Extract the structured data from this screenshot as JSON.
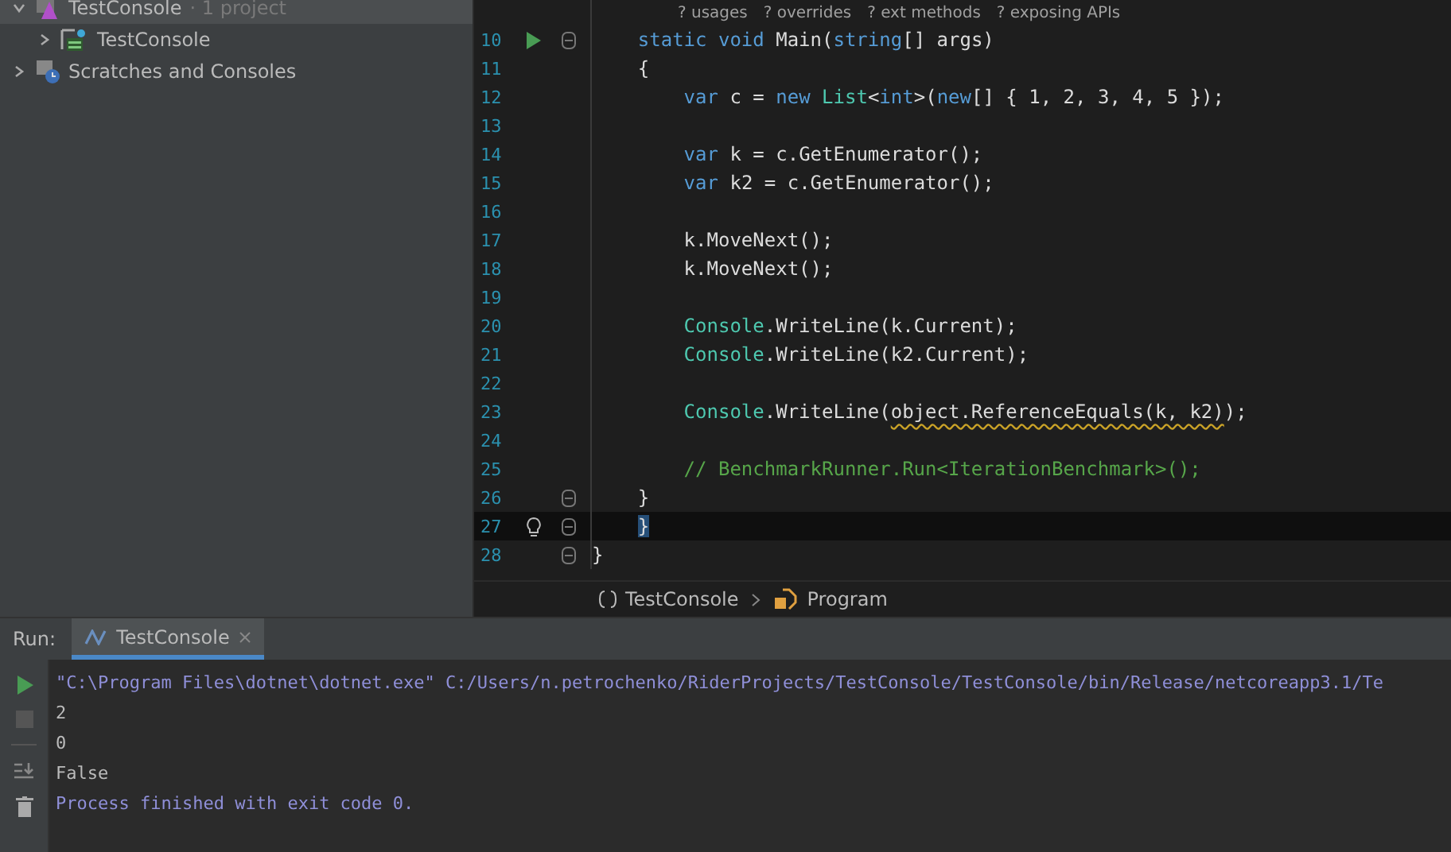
{
  "project_tree": [
    {
      "label": "TestConsole",
      "note": "· 1 project",
      "kind": "solution",
      "expanded": true,
      "selected": true,
      "children": [
        {
          "label": "TestConsole",
          "kind": "project",
          "expanded": false,
          "selected": false
        }
      ]
    },
    {
      "label": "Scratches and Consoles",
      "kind": "scratches",
      "expanded": false,
      "selected": false
    }
  ],
  "editor": {
    "code_lens": [
      "? usages",
      "? overrides",
      "? ext methods",
      "? exposing APIs"
    ],
    "lines": [
      {
        "number": "10",
        "kind": "runnable",
        "fold": true,
        "current": false,
        "tokens": [
          {
            "kind": "kw",
            "text": "    static void "
          },
          {
            "kind": "plain",
            "text": "Main("
          },
          {
            "kind": "kw",
            "text": "string"
          },
          {
            "kind": "plain",
            "text": "[] args)"
          }
        ]
      },
      {
        "number": "11",
        "kind": "plain",
        "fold": false,
        "current": false,
        "tokens": [
          {
            "kind": "plain",
            "text": "    {"
          }
        ]
      },
      {
        "number": "12",
        "kind": "plain",
        "fold": false,
        "current": false,
        "tokens": [
          {
            "kind": "kw",
            "text": "        var"
          },
          {
            "kind": "plain",
            "text": " c = "
          },
          {
            "kind": "kw",
            "text": "new "
          },
          {
            "kind": "type",
            "text": "List"
          },
          {
            "kind": "plain",
            "text": "<"
          },
          {
            "kind": "kw",
            "text": "int"
          },
          {
            "kind": "plain",
            "text": ">("
          },
          {
            "kind": "kw",
            "text": "new"
          },
          {
            "kind": "plain",
            "text": "[] { 1, 2, 3, 4, 5 });"
          }
        ]
      },
      {
        "number": "13",
        "kind": "plain",
        "fold": false,
        "current": false
      },
      {
        "number": "14",
        "kind": "plain",
        "fold": false,
        "current": false,
        "tokens": [
          {
            "kind": "kw",
            "text": "        var"
          },
          {
            "kind": "plain",
            "text": " k = c.GetEnumerator();"
          }
        ]
      },
      {
        "number": "15",
        "kind": "plain",
        "fold": false,
        "current": false,
        "tokens": [
          {
            "kind": "kw",
            "text": "        var"
          },
          {
            "kind": "plain",
            "text": " k2 = c.GetEnumerator();"
          }
        ]
      },
      {
        "number": "16",
        "kind": "plain",
        "fold": false,
        "current": false
      },
      {
        "number": "17",
        "kind": "plain",
        "fold": false,
        "current": false,
        "tokens": [
          {
            "kind": "plain",
            "text": "        k.MoveNext();"
          }
        ]
      },
      {
        "number": "18",
        "kind": "plain",
        "fold": false,
        "current": false,
        "tokens": [
          {
            "kind": "plain",
            "text": "        k.MoveNext();"
          }
        ]
      },
      {
        "number": "19",
        "kind": "plain",
        "fold": false,
        "current": false
      },
      {
        "number": "20",
        "kind": "plain",
        "fold": false,
        "current": false,
        "tokens": [
          {
            "kind": "type",
            "text": "        Console"
          },
          {
            "kind": "plain",
            "text": ".WriteLine(k.Current);"
          }
        ]
      },
      {
        "number": "21",
        "kind": "plain",
        "fold": false,
        "current": false,
        "tokens": [
          {
            "kind": "type",
            "text": "        Console"
          },
          {
            "kind": "plain",
            "text": ".WriteLine(k2.Current);"
          }
        ]
      },
      {
        "number": "22",
        "kind": "plain",
        "fold": false,
        "current": false
      },
      {
        "number": "23",
        "kind": "plain",
        "fold": false,
        "current": false,
        "tokens": [
          {
            "kind": "type",
            "text": "        Console"
          },
          {
            "kind": "plain",
            "text": ".WriteLine("
          },
          {
            "kind": "warning",
            "text": "object.ReferenceEquals(k, k2)"
          },
          {
            "kind": "plain",
            "text": ");"
          }
        ]
      },
      {
        "number": "24",
        "kind": "plain",
        "fold": false,
        "current": false
      },
      {
        "number": "25",
        "kind": "plain",
        "fold": false,
        "current": false,
        "tokens": [
          {
            "kind": "comment",
            "text": "        // BenchmarkRunner.Run<IterationBenchmark>();"
          }
        ]
      },
      {
        "number": "26",
        "kind": "plain",
        "fold": true,
        "current": false,
        "tokens": [
          {
            "kind": "plain",
            "text": "    }"
          }
        ]
      },
      {
        "number": "27",
        "kind": "intention",
        "fold": true,
        "current": true,
        "tokens": [
          {
            "kind": "selected",
            "text": "    }"
          }
        ]
      },
      {
        "number": "28",
        "kind": "plain",
        "fold": true,
        "current": false,
        "tokens": [
          {
            "kind": "plain",
            "text": "}"
          }
        ]
      }
    ]
  },
  "breadcrumbs": [
    {
      "label": "TestConsole",
      "kind": "namespace"
    },
    {
      "label": "Program",
      "kind": "class"
    }
  ],
  "run_panel": {
    "title": "Run:",
    "tabs": [
      {
        "label": "TestConsole",
        "selected": true
      }
    ],
    "output": [
      {
        "kind": "system",
        "text": "\"C:\\Program Files\\dotnet\\dotnet.exe\" C:/Users/n.petrochenko/RiderProjects/TestConsole/TestConsole/bin/Release/netcoreapp3.1/Te"
      },
      {
        "kind": "stdout",
        "text": "2"
      },
      {
        "kind": "stdout",
        "text": "0"
      },
      {
        "kind": "stdout",
        "text": "False"
      },
      {
        "kind": "system",
        "text": "Process finished with exit code 0."
      }
    ]
  }
}
